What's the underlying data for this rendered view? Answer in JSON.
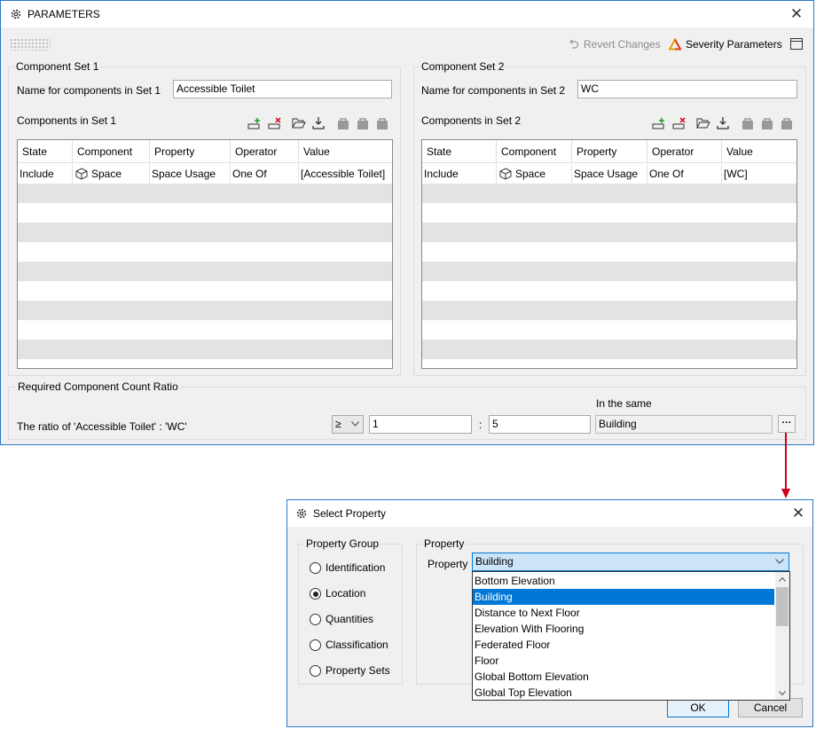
{
  "main_window": {
    "title": "PARAMETERS",
    "revert_label": "Revert Changes",
    "severity_label": "Severity Parameters",
    "set1": {
      "group_title": "Component Set 1",
      "name_label": "Name for components in Set 1",
      "name_value": "Accessible Toilet",
      "components_label": "Components in Set 1",
      "columns": [
        "State",
        "Component",
        "Property",
        "Operator",
        "Value"
      ],
      "rows": [
        {
          "state": "Include",
          "component": "Space",
          "property": "Space Usage",
          "operator": "One Of",
          "value": "[Accessible Toilet]"
        }
      ]
    },
    "set2": {
      "group_title": "Component Set 2",
      "name_label": "Name for components in Set 2",
      "name_value": "WC",
      "components_label": "Components in Set 2",
      "columns": [
        "State",
        "Component",
        "Property",
        "Operator",
        "Value"
      ],
      "rows": [
        {
          "state": "Include",
          "component": "Space",
          "property": "Space Usage",
          "operator": "One Of",
          "value": "[WC]"
        }
      ]
    },
    "ratio": {
      "group_title": "Required Component Count Ratio",
      "ratio_label": "The ratio of 'Accessible Toilet' : 'WC'",
      "operator": "≥",
      "left_value": "1",
      "separator": ":",
      "right_value": "5",
      "in_same_label": "In the same",
      "in_same_value": "Building",
      "ellipsis_label": "···"
    }
  },
  "dialog": {
    "title": "Select Property",
    "property_group": {
      "title": "Property Group",
      "options": [
        {
          "label": "Identification",
          "selected": false
        },
        {
          "label": "Location",
          "selected": true
        },
        {
          "label": "Quantities",
          "selected": false
        },
        {
          "label": "Classification",
          "selected": false
        },
        {
          "label": "Property Sets",
          "selected": false
        }
      ]
    },
    "property": {
      "group_title": "Property",
      "label": "Property",
      "selected_value": "Building",
      "dropdown_items": [
        "Bottom Elevation",
        "Building",
        "Distance to Next Floor",
        "Elevation With Flooring",
        "Federated Floor",
        "Floor",
        "Global Bottom Elevation",
        "Global Top Elevation"
      ],
      "highlighted_index": 1
    },
    "ok_label": "OK",
    "cancel_label": "Cancel"
  },
  "colors": {
    "window_border": "#2b78c8",
    "selection": "#0078d7",
    "connector_arrow": "#d0021b",
    "severity_icon": "#e8a200"
  },
  "icons": [
    "gear-icon",
    "close-icon",
    "undo-icon",
    "warning-triangle-icon",
    "window-icon",
    "add-row-icon",
    "delete-row-icon",
    "open-folder-icon",
    "download-icon",
    "bag-icon",
    "cube-icon",
    "chevron-down-icon"
  ]
}
